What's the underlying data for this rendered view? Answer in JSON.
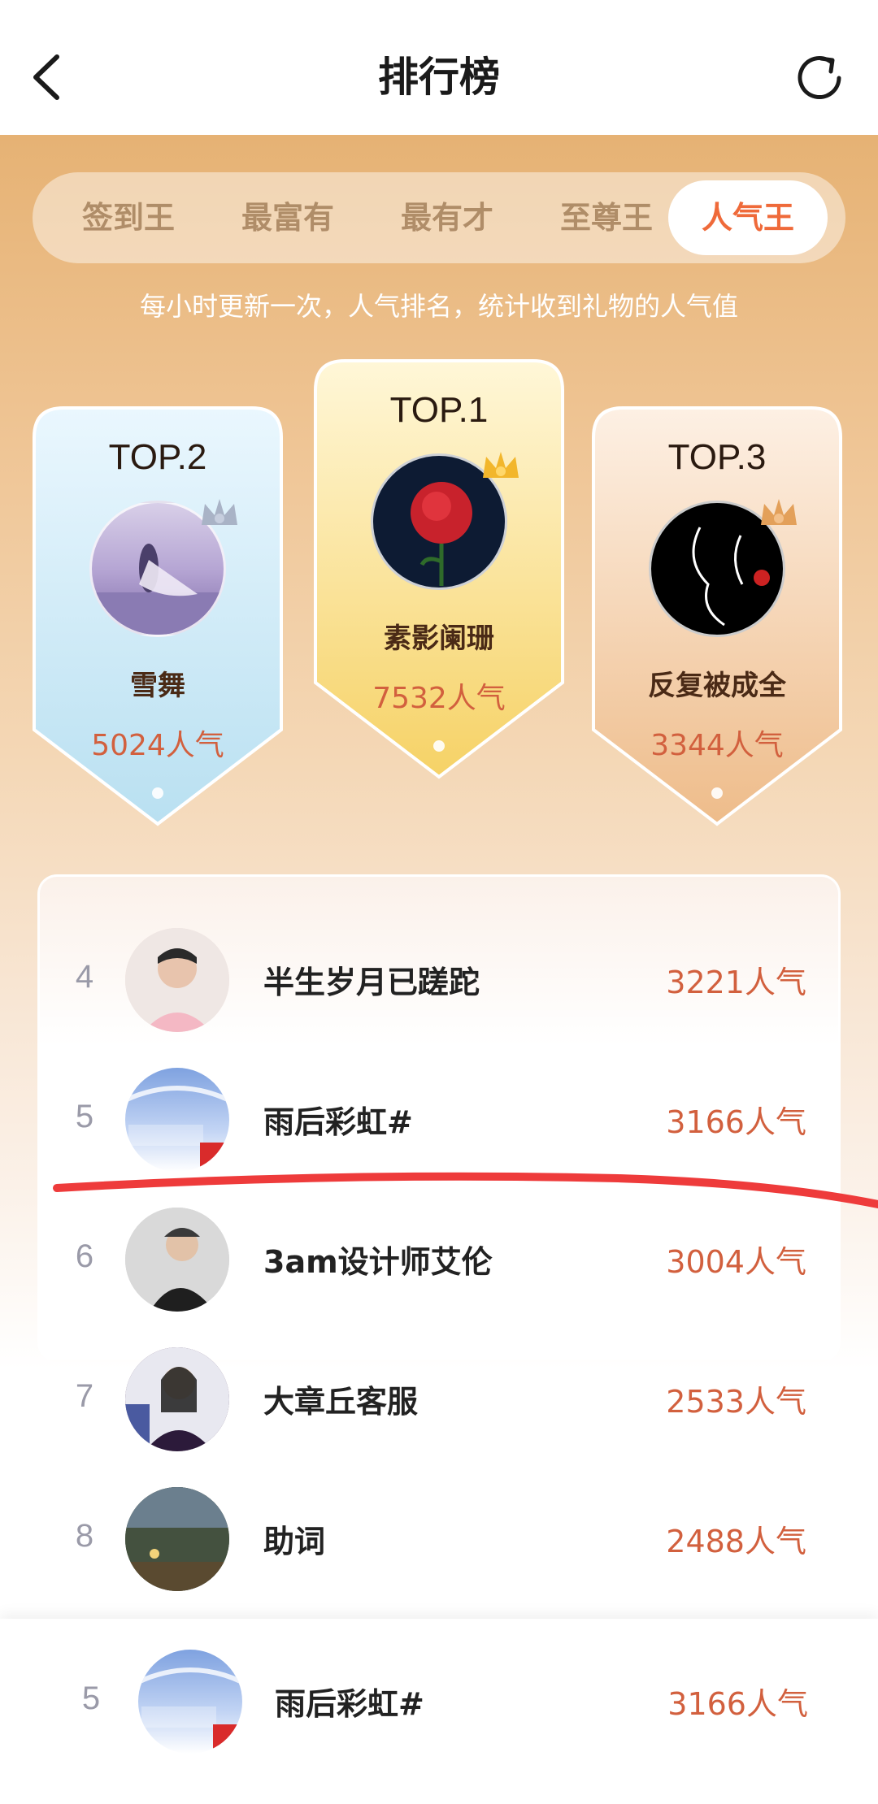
{
  "header": {
    "title": "排行榜",
    "back_icon": "chevron-left-icon",
    "refresh_icon": "refresh-icon"
  },
  "tabs": [
    {
      "label": "签到王",
      "active": false
    },
    {
      "label": "最富有",
      "active": false
    },
    {
      "label": "最有才",
      "active": false
    },
    {
      "label": "至尊王",
      "active": false
    },
    {
      "label": "人气王",
      "active": true
    }
  ],
  "subtitle": "每小时更新一次，人气排名，统计收到礼物的人气值",
  "podium": {
    "first": {
      "label": "TOP.1",
      "name": "素影阑珊",
      "score": "7532人气"
    },
    "second": {
      "label": "TOP.2",
      "name": "雪舞",
      "score": "5024人气"
    },
    "third": {
      "label": "TOP.3",
      "name": "反复被成全",
      "score": "3344人气"
    }
  },
  "ranking": [
    {
      "rank": "4",
      "name": "半生岁月已蹉跎",
      "score": "3221人气"
    },
    {
      "rank": "5",
      "name": "雨后彩虹#",
      "score": "3166人气"
    },
    {
      "rank": "6",
      "name": "3am设计师艾伦",
      "score": "3004人气"
    },
    {
      "rank": "7",
      "name": "大章丘客服",
      "score": "2533人气"
    },
    {
      "rank": "8",
      "name": "助词",
      "score": "2488人气"
    }
  ],
  "my_rank": {
    "rank": "5",
    "name": "雨后彩虹#",
    "score": "3166人气"
  },
  "colors": {
    "accent": "#ef6a3a",
    "score": "#d2603e",
    "annotation_line": "#ee3b3b"
  }
}
